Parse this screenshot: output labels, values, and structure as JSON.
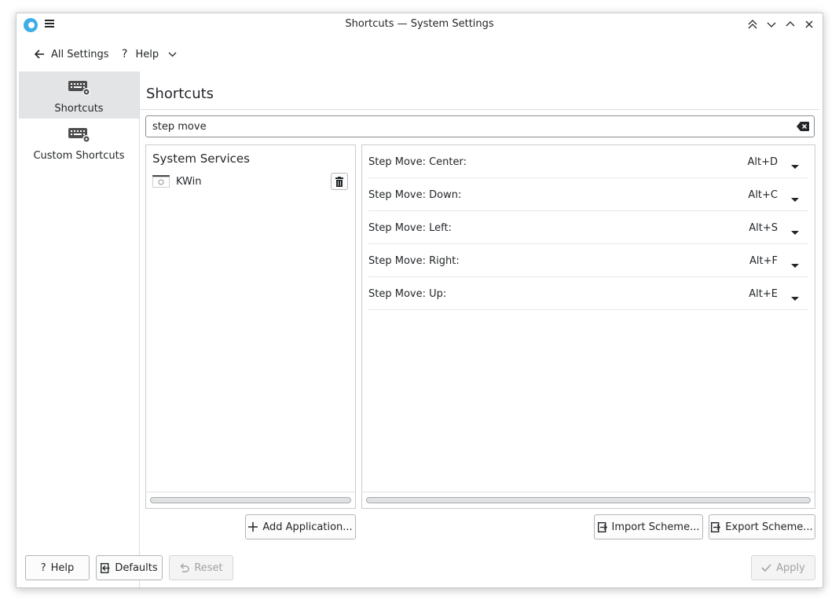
{
  "window": {
    "title": "Shortcuts — System Settings"
  },
  "toolbar": {
    "back_label": "All Settings",
    "help_label": "Help"
  },
  "sidebar": {
    "items": [
      {
        "label": "Shortcuts",
        "active": true
      },
      {
        "label": "Custom Shortcuts",
        "active": false
      }
    ]
  },
  "main": {
    "title": "Shortcuts",
    "search": {
      "value": "step move",
      "placeholder": ""
    },
    "left_panel": {
      "header": "System Services",
      "apps": [
        {
          "name": "KWin"
        }
      ]
    },
    "shortcuts": [
      {
        "name": "Step Move: Center:",
        "key": "Alt+D"
      },
      {
        "name": "Step Move: Down:",
        "key": "Alt+C"
      },
      {
        "name": "Step Move: Left:",
        "key": "Alt+S"
      },
      {
        "name": "Step Move: Right:",
        "key": "Alt+F"
      },
      {
        "name": "Step Move: Up:",
        "key": "Alt+E"
      }
    ],
    "add_application_label": "Add Application...",
    "import_scheme_label": "Import Scheme...",
    "export_scheme_label": "Export Scheme..."
  },
  "footer": {
    "help_label": "Help",
    "defaults_label": "Defaults",
    "reset_label": "Reset",
    "apply_label": "Apply"
  },
  "colors": {
    "accent": "#3daee9",
    "active_item_bg": "#e3e4e5",
    "text": "#232629",
    "disabled_text": "#a0a2a4"
  }
}
